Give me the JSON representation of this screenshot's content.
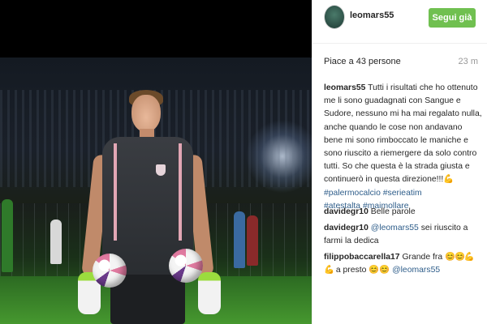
{
  "post": {
    "author": "leomars55",
    "follow_label": "Segui già",
    "likes_text": "Piace a 43 persone",
    "time_ago": "23 m",
    "caption": {
      "username": "leomars55",
      "text": "Tutti i risultati che ho ottenuto me li sono guadagnati con Sangue e Sudore, nessuno mi ha mai regalato nulla, anche quando le cose non andavano bene mi sono rimboccato le maniche e sono riuscito a riemergere da solo contro tutti. So che questa è la strada giusta e continuerò in questa direzione!!!",
      "emoji": "💪",
      "hashtags": [
        "#palermocalcio",
        "#serieatim",
        "#atestalta",
        "#maimollare"
      ]
    },
    "comments": [
      {
        "username": "davidegr10",
        "text": "Belle parole"
      },
      {
        "username": "davidegr10",
        "mention": "@leomars55",
        "text": "sei riuscito a farmi la dedica"
      },
      {
        "username": "filippobaccarella17",
        "text_before": "Grande fra",
        "emoji": "😊😊💪💪",
        "text_mid": "a presto",
        "emoji2": "😊😊",
        "mention": "@leomars55"
      }
    ]
  },
  "colors": {
    "follow_bg": "#70c050",
    "link": "#2e5d8a",
    "pitch": "#46982f"
  }
}
